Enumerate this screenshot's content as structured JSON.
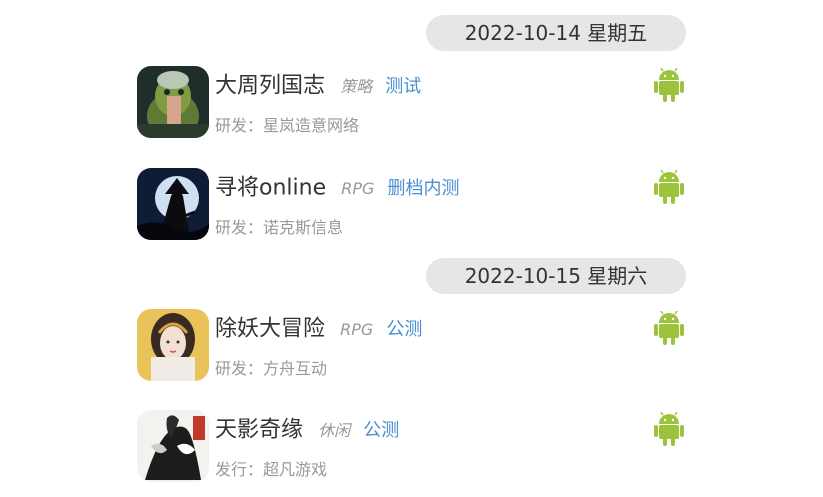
{
  "groups": [
    {
      "date": "2022-10-14 星期五",
      "games": [
        {
          "name": "大周列国志",
          "genre": "策略",
          "status": "测试",
          "developer": "研发：星岚造意网络",
          "platform": "android-icon"
        },
        {
          "name": "寻将online",
          "genre": "RPG",
          "status": "删档内测",
          "developer": "研发：诺克斯信息",
          "platform": "android-icon"
        }
      ]
    },
    {
      "date": "2022-10-15 星期六",
      "games": [
        {
          "name": "除妖大冒险",
          "genre": "RPG",
          "status": "公测",
          "developer": "研发：方舟互动",
          "platform": "android-icon"
        },
        {
          "name": "天影奇缘",
          "genre": "休闲",
          "status": "公测",
          "developer": "发行：超凡游戏",
          "platform": "android-icon"
        }
      ]
    }
  ],
  "colors": {
    "status_link": "#4a8fd6",
    "android_green": "#9bc43c",
    "pill_bg": "#e6e6e6"
  }
}
